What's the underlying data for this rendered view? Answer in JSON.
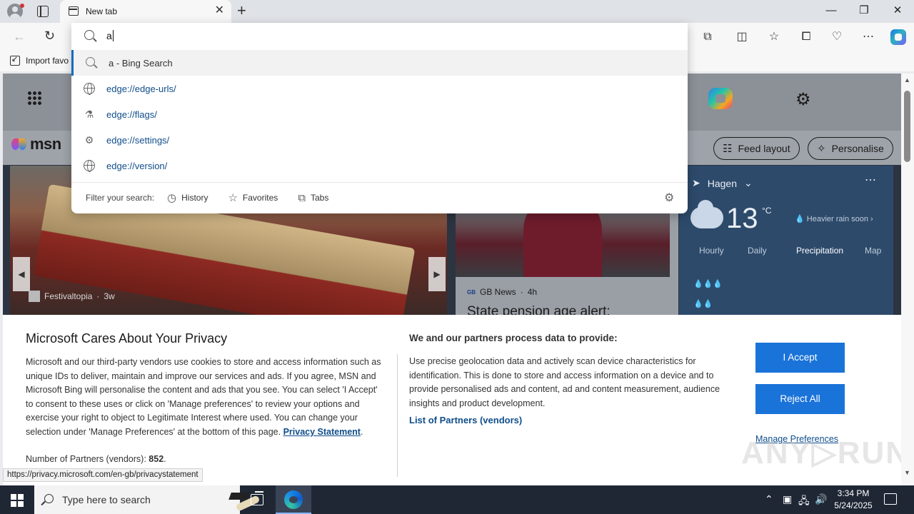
{
  "browser": {
    "tab_title": "New tab",
    "favorites_import": "Import favo",
    "omnibox": {
      "query": "a",
      "suggestions": [
        {
          "text": "a - Bing Search",
          "icon": "search-icon",
          "selected": true
        },
        {
          "text": "edge://edge-urls/",
          "icon": "globe-icon"
        },
        {
          "text": "edge://flags/",
          "icon": "flask-icon"
        },
        {
          "text": "edge://settings/",
          "icon": "gear-icon"
        },
        {
          "text": "edge://version/",
          "icon": "globe-icon"
        }
      ],
      "filter_label": "Filter your search:",
      "filters": [
        "History",
        "Favorites",
        "Tabs"
      ]
    }
  },
  "msn": {
    "logo_text": "msn",
    "feed_layout": "Feed layout",
    "personalise": "Personalise",
    "hero_source": "Festivaltopia",
    "hero_age": "3w",
    "news": {
      "source": "GB News",
      "age": "4h",
      "title": "State pension age alert:"
    },
    "weather": {
      "location": "Hagen",
      "temp": "13",
      "unit": "°C",
      "note": "Heavier rain soon",
      "tabs": [
        "Hourly",
        "Daily",
        "Precipitation",
        "Map"
      ],
      "active_tab": "Precipitation"
    }
  },
  "privacy": {
    "title": "Microsoft Cares About Your Privacy",
    "body": "Microsoft and our third-party vendors use cookies to store and access information such as unique IDs to deliver, maintain and improve our services and ads. If you agree, MSN and Microsoft Bing will personalise the content and ads that you see. You can select 'I Accept' to consent to these uses or click on 'Manage preferences' to review your options and exercise your right to object to Legitimate Interest where used.  You can change your selection under 'Manage Preferences' at the bottom of this page.",
    "statement_link": "Privacy Statement",
    "partners_label": "Number of Partners (vendors):",
    "partners_count": "852",
    "right_heading": "We and our partners process data to provide:",
    "right_body": "Use precise geolocation data and actively scan device characteristics for identification. This is done to store and access information on a device and to provide personalised ads and content, ad and content measurement, audience insights and product development.",
    "list_partners": "List of Partners (vendors)",
    "accept": "I Accept",
    "reject": "Reject All",
    "manage": "Manage Preferences"
  },
  "status_url": "https://privacy.microsoft.com/en-gb/privacystatement",
  "taskbar": {
    "search_placeholder": "Type here to search",
    "time": "3:34 PM",
    "date": "5/24/2025"
  }
}
